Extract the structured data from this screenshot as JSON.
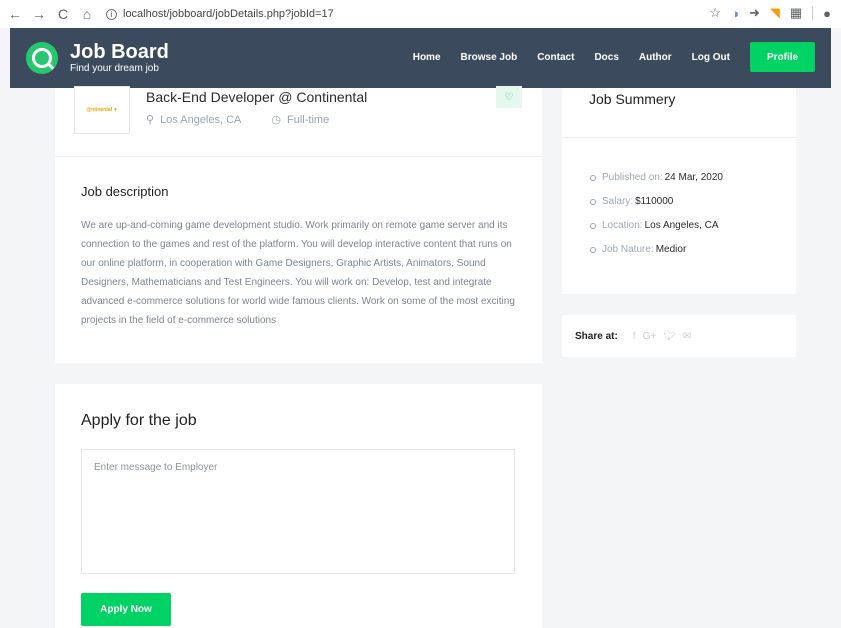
{
  "browser": {
    "url": "localhost/jobboard/jobDetails.php?jobId=17",
    "back_icon": "arrow-left-icon",
    "forward_icon": "arrow-right-icon",
    "reload_icon": "reload-icon",
    "home_icon": "home-icon"
  },
  "header": {
    "brand_title": "Job Board",
    "brand_subtitle": "Find your dream job",
    "menu": [
      "Home",
      "Browse Job",
      "Contact",
      "Docs",
      "Author",
      "Log Out"
    ],
    "profile_label": "Profile"
  },
  "job": {
    "company_logo_text": "@ntinental ✦",
    "title": "Back-End Developer @ Continental",
    "location": "Los Angeles, CA",
    "type": "Full-time",
    "description_title": "Job description",
    "description": "We are up-and-coming game development studio. Work primarily on remote game server and its connection to the games and rest of the platform. You will develop interactive content that runs on our online platform, in cooperation with Game Designers, Graphic Artists, Animators, Sound Designers, Mathematicians and Test Engineers. You will work on: Develop, test and integrate advanced e-commerce solutions for world wide famous clients. Work on some of the most exciting projects in the field of e-commerce solutions"
  },
  "summary": {
    "title": "Job Summery",
    "items": [
      {
        "label": "Published on:",
        "value": "24 Mar, 2020"
      },
      {
        "label": "Salary:",
        "value": "$110000"
      },
      {
        "label": "Location:",
        "value": "Los Angeles, CA"
      },
      {
        "label": "Job Nature:",
        "value": "Medior"
      }
    ]
  },
  "share": {
    "label": "Share at:",
    "icons": [
      "facebook-icon",
      "google-plus-icon",
      "twitter-icon",
      "mail-icon"
    ]
  },
  "apply": {
    "title": "Apply for the job",
    "message_placeholder": "Enter message to Employer",
    "button_label": "Apply Now"
  },
  "colors": {
    "accent": "#00d363",
    "header_bg": "#3b4a5c",
    "page_bg": "#f4f5f7"
  }
}
